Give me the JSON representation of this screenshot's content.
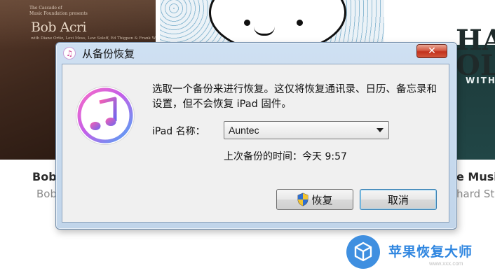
{
  "background": {
    "album_left": {
      "credit": "The Cascade of\nMusic Foundation presents",
      "artist": "Bob Acri",
      "subtitle": "with Diane Ortiz, Levi Moss, Lew Soloff, Ed Thigpen & Frank Wess",
      "title_below": "Bob",
      "subtitle_below": "Bob"
    },
    "album_right": {
      "big_text_line1": "HAR",
      "big_text_line2": "OLT",
      "with_text": "WITH",
      "title_below": "e Music",
      "subtitle_below": "hard Sto"
    }
  },
  "dialog": {
    "title": "从备份恢复",
    "close_label": "✕",
    "message": "选取一个备份来进行恢复。这仅将恢复通讯录、日历、备忘录和设置，但不会恢复 iPad 固件。",
    "name_label": "iPad 名称：",
    "device_select": {
      "value": "Auntec"
    },
    "last_backup": "上次备份的时间：今天 9:57",
    "restore_button": "恢复",
    "cancel_button": "取消"
  },
  "watermark": {
    "text": "苹果恢复大师",
    "url": "www.xxx.com"
  },
  "colors": {
    "accent": "#3f8fe0",
    "close_red": "#c2301c",
    "dialog_frame": "#c1d5ea"
  },
  "icons": {
    "itunes": "itunes-icon",
    "shield": "uac-shield-icon",
    "dropdown": "chevron-down-icon",
    "close": "close-icon",
    "watermark_logo": "cube-logo-icon"
  }
}
